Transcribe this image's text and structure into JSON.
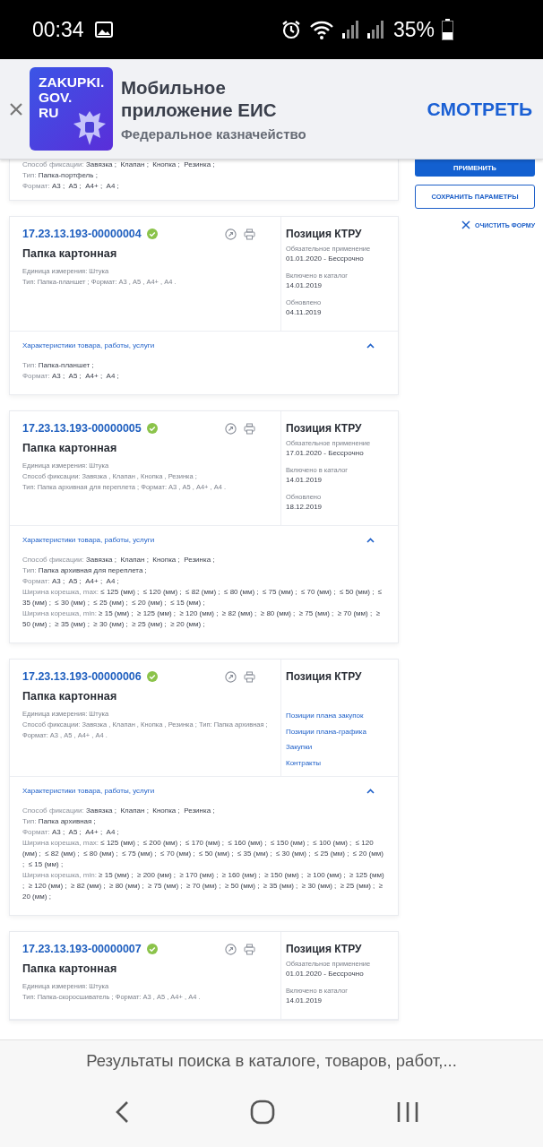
{
  "status_bar": {
    "time": "00:34",
    "battery": "35%"
  },
  "banner": {
    "logo_lines": [
      "ZAKUPKI.",
      "GOV.",
      "RU"
    ],
    "title": "Мобильное приложение ЕИС",
    "subtitle": "Федеральное казначейство",
    "action": "СМОТРЕТЬ"
  },
  "filters": {
    "apply": "ПРИМЕНИТЬ",
    "save": "СОХРАНИТЬ ПАРАМЕТРЫ",
    "clear": "ОЧИСТИТЬ ФОРМУ"
  },
  "partial_card": {
    "lines": [
      {
        "label": "Способ фиксации:",
        "value": "Завязка ;  Клапан ;  Кнопка ;  Резинка ;"
      },
      {
        "label": "Тип:",
        "value": "Папка-портфель ;"
      },
      {
        "label": "Формат:",
        "value": "А3 ;  А5 ;  А4+ ;  А4 ;"
      }
    ]
  },
  "cards": [
    {
      "code": "17.23.13.193-00000004",
      "name": "Папка картонная",
      "details": [
        "Единица измерения: Штука",
        "Тип: Папка-планшет ; Формат: А3 , А5 , А4+ , А4 ."
      ],
      "panel": {
        "title": "Позиция КТРУ",
        "items": [
          {
            "kind": "date",
            "label": "Обязательное применение",
            "value": "01.01.2020  - Бессрочно"
          },
          {
            "kind": "date",
            "label": "Включено в каталог",
            "value": "14.01.2019"
          },
          {
            "kind": "date",
            "label": "Обновлено",
            "value": "04.11.2019"
          }
        ]
      },
      "characteristics": {
        "title": "Характеристики товара, работы, услуги",
        "expanded": true,
        "lines": [
          {
            "label": "Тип:",
            "value": "Папка-планшет ;"
          },
          {
            "label": "Формат:",
            "value": "А3 ;  А5 ;  А4+ ;  А4 ;"
          }
        ]
      }
    },
    {
      "code": "17.23.13.193-00000005",
      "name": "Папка картонная",
      "details": [
        "Единица измерения: Штука",
        "Способ фиксации: Завязка , Клапан , Кнопка , Резинка ;",
        "Тип: Папка архивная для переплета ; Формат: А3 , А5 , А4+ , А4 ."
      ],
      "panel": {
        "title": "Позиция КТРУ",
        "items": [
          {
            "kind": "date",
            "label": "Обязательное применение",
            "value": "17.01.2020  - Бессрочно"
          },
          {
            "kind": "date",
            "label": "Включено в каталог",
            "value": "14.01.2019"
          },
          {
            "kind": "date",
            "label": "Обновлено",
            "value": "18.12.2019"
          }
        ]
      },
      "characteristics": {
        "title": "Характеристики товара, работы, услуги",
        "expanded": true,
        "lines": [
          {
            "label": "Способ фиксации:",
            "value": "Завязка ;  Клапан ;  Кнопка ;  Резинка ;"
          },
          {
            "label": "Тип:",
            "value": "Папка архивная для переплета ;"
          },
          {
            "label": "Формат:",
            "value": "А3 ;  А5 ;  А4+ ;  А4 ;"
          },
          {
            "label": "Ширина корешка, max:",
            "value": "≤ 125 (мм) ;  ≤ 120 (мм) ;  ≤ 82 (мм) ;  ≤ 80 (мм) ;  ≤ 75 (мм) ;  ≤ 70 (мм) ;  ≤ 50 (мм) ;  ≤ 35 (мм) ;  ≤ 30 (мм) ;  ≤ 25 (мм) ;  ≤ 20 (мм) ;  ≤ 15 (мм) ;"
          },
          {
            "label": "Ширина корешка, min:",
            "value": "≥ 15 (мм) ;  ≥ 125 (мм) ;  ≥ 120 (мм) ;  ≥ 82 (мм) ;  ≥ 80 (мм) ;  ≥ 75 (мм) ;  ≥ 70 (мм) ;  ≥ 50 (мм) ;  ≥ 35 (мм) ;  ≥ 30 (мм) ;  ≥ 25 (мм) ;  ≥ 20 (мм) ;"
          }
        ]
      }
    },
    {
      "code": "17.23.13.193-00000006",
      "name": "Папка картонная",
      "details": [
        "Единица измерения: Штука",
        "Способ фиксации: Завязка , Клапан , Кнопка , Резинка ; Тип: Папка архивная ;",
        "Формат: А3 , А5 , А4+ , А4 ."
      ],
      "panel": {
        "title": "Позиция КТРУ",
        "items": [
          {
            "kind": "link",
            "label": "Позиции плана закупок"
          },
          {
            "kind": "link",
            "label": "Позиции плана-графика"
          },
          {
            "kind": "link",
            "label": "Закупки"
          },
          {
            "kind": "link",
            "label": "Контракты"
          }
        ]
      },
      "characteristics": {
        "title": "Характеристики товара, работы, услуги",
        "expanded": true,
        "lines": [
          {
            "label": "Способ фиксации:",
            "value": "Завязка ;  Клапан ;  Кнопка ;  Резинка ;"
          },
          {
            "label": "Тип:",
            "value": "Папка архивная ;"
          },
          {
            "label": "Формат:",
            "value": "А3 ;  А5 ;  А4+ ;  А4 ;"
          },
          {
            "label": "Ширина корешка, max:",
            "value": "≤ 125 (мм) ;  ≤ 200 (мм) ;  ≤ 170 (мм) ;  ≤ 160 (мм) ;  ≤ 150 (мм) ;  ≤ 100 (мм) ;  ≤ 120 (мм) ;  ≤ 82 (мм) ;  ≤ 80 (мм) ;  ≤ 75 (мм) ;  ≤ 70 (мм) ;  ≤ 50 (мм) ;  ≤ 35 (мм) ;  ≤ 30 (мм) ;  ≤ 25 (мм) ;  ≤ 20 (мм) ;  ≤ 15 (мм) ;"
          },
          {
            "label": "Ширина корешка, min:",
            "value": "≥ 15 (мм) ;  ≥ 200 (мм) ;  ≥ 170 (мм) ;  ≥ 160 (мм) ;  ≥ 150 (мм) ;  ≥ 100 (мм) ;  ≥ 125 (мм) ;  ≥ 120 (мм) ;  ≥ 82 (мм) ;  ≥ 80 (мм) ;  ≥ 75 (мм) ;  ≥ 70 (мм) ;  ≥ 50 (мм) ;  ≥ 35 (мм) ;  ≥ 30 (мм) ;  ≥ 25 (мм) ;  ≥ 20 (мм) ;"
          }
        ]
      }
    },
    {
      "code": "17.23.13.193-00000007",
      "name": "Папка картонная",
      "details": [
        "Единица измерения: Штука",
        "Тип: Папка-скоросшиватель ; Формат: А3 , А5 , А4+ , А4 ."
      ],
      "panel": {
        "title": "Позиция КТРУ",
        "items": [
          {
            "kind": "date",
            "label": "Обязательное применение",
            "value": "01.01.2020  - Бессрочно"
          },
          {
            "kind": "date",
            "label": "Включено в каталог",
            "value": "14.01.2019"
          }
        ]
      }
    }
  ],
  "browser": {
    "page_title": "Результаты поиска в каталоге, товаров, работ,..."
  }
}
